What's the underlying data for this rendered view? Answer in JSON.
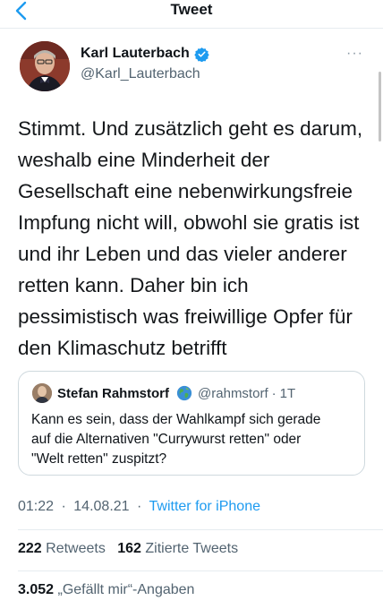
{
  "header": {
    "back_label": "<",
    "title": "Tweet"
  },
  "author": {
    "name": "Karl Lauterbach",
    "handle": "@Karl_Lauterbach",
    "verified": true,
    "more_label": "···"
  },
  "tweet": {
    "lines": [
      "Stimmt. Und zusätzlich geht es darum,",
      "weshalb eine Minderheit der",
      "Gesellschaft eine nebenwirkungsfreie",
      "Impfung nicht will, obwohl sie gratis ist",
      "und ihr Leben und das vieler anderer",
      "retten kann. Daher bin ich",
      "pessimistisch was freiwillige Opfer für",
      "den Klimaschutz betrifft"
    ]
  },
  "quote": {
    "name": "Stefan Rahmstorf",
    "handle": "@rahmstorf",
    "dot": "·",
    "time": "1T",
    "lines": [
      "Kann es sein, dass der Wahlkampf sich gerade",
      "auf die Alternativen \"Currywurst retten\" oder",
      "\"Welt retten\" zuspitzt?"
    ]
  },
  "meta": {
    "time": "01:22",
    "sep1": "·",
    "date": "14.08.21",
    "sep2": "·",
    "source": "Twitter for iPhone"
  },
  "stats": {
    "retweets_count": "222",
    "retweets_label": "Retweets",
    "quotes_count": "162",
    "quotes_label": "Zitierte Tweets",
    "likes_count": "3.052",
    "likes_label": "„Gefällt mir“-Angaben"
  },
  "colors": {
    "link": "#1d9bf0",
    "verified": "#1d9bf0",
    "muted": "#536471"
  }
}
